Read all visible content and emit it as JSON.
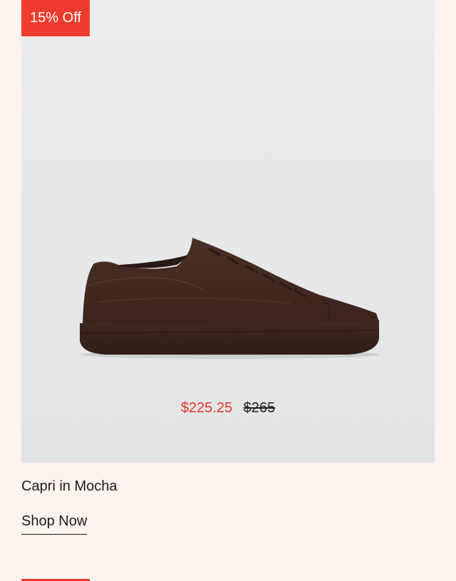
{
  "badge": {
    "label": "15% Off",
    "color": "#ef3b2d"
  },
  "product": {
    "image_icon": "brown-low-top-sneaker",
    "sale_price": "$225.25",
    "original_price": "$265",
    "name": "Capri in Mocha",
    "cta_label": "Shop Now"
  }
}
